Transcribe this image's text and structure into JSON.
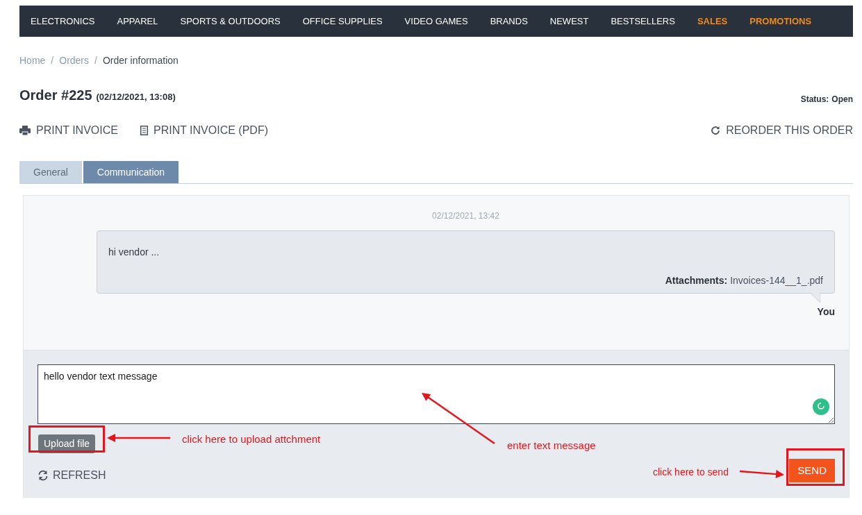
{
  "nav": {
    "items": [
      {
        "label": "ELECTRONICS",
        "highlighted": false
      },
      {
        "label": "APPAREL",
        "highlighted": false
      },
      {
        "label": "SPORTS & OUTDOORS",
        "highlighted": false
      },
      {
        "label": "OFFICE SUPPLIES",
        "highlighted": false
      },
      {
        "label": "VIDEO GAMES",
        "highlighted": false
      },
      {
        "label": "BRANDS",
        "highlighted": false
      },
      {
        "label": "NEWEST",
        "highlighted": false
      },
      {
        "label": "BESTSELLERS",
        "highlighted": false
      },
      {
        "label": "SALES",
        "highlighted": true
      },
      {
        "label": "PROMOTIONS",
        "highlighted": true
      }
    ]
  },
  "breadcrumb": {
    "separator": "/",
    "items": [
      {
        "label": "Home",
        "current": false
      },
      {
        "label": "Orders",
        "current": false
      },
      {
        "label": "Order information",
        "current": true
      }
    ]
  },
  "order": {
    "title": "Order #225",
    "date": "(02/12/2021, 13:08)",
    "status_label": "Status:",
    "status_value": "Open"
  },
  "actions": [
    {
      "kind": "print",
      "label": "PRINT INVOICE"
    },
    {
      "kind": "pdf",
      "label": "PRINT INVOICE (PDF)"
    },
    {
      "kind": "reorder",
      "label": "REORDER THIS ORDER"
    }
  ],
  "tabs": [
    {
      "label": "General",
      "selected": false
    },
    {
      "label": "Communication",
      "selected": true
    }
  ],
  "messages": [
    {
      "timestamp": "02/12/2021, 13:42",
      "text": "hi vendor ...",
      "attachments_label": "Attachments:",
      "attachment": "Invoices-144__1_.pdf",
      "author": "You"
    }
  ],
  "composer": {
    "value": "hello vendor text message",
    "upload_button": "Upload file",
    "refresh": "REFRESH",
    "send": "SEND"
  },
  "callouts": {
    "upload": "click here to upload attchment",
    "message": "enter text message",
    "send": "click here to send"
  }
}
